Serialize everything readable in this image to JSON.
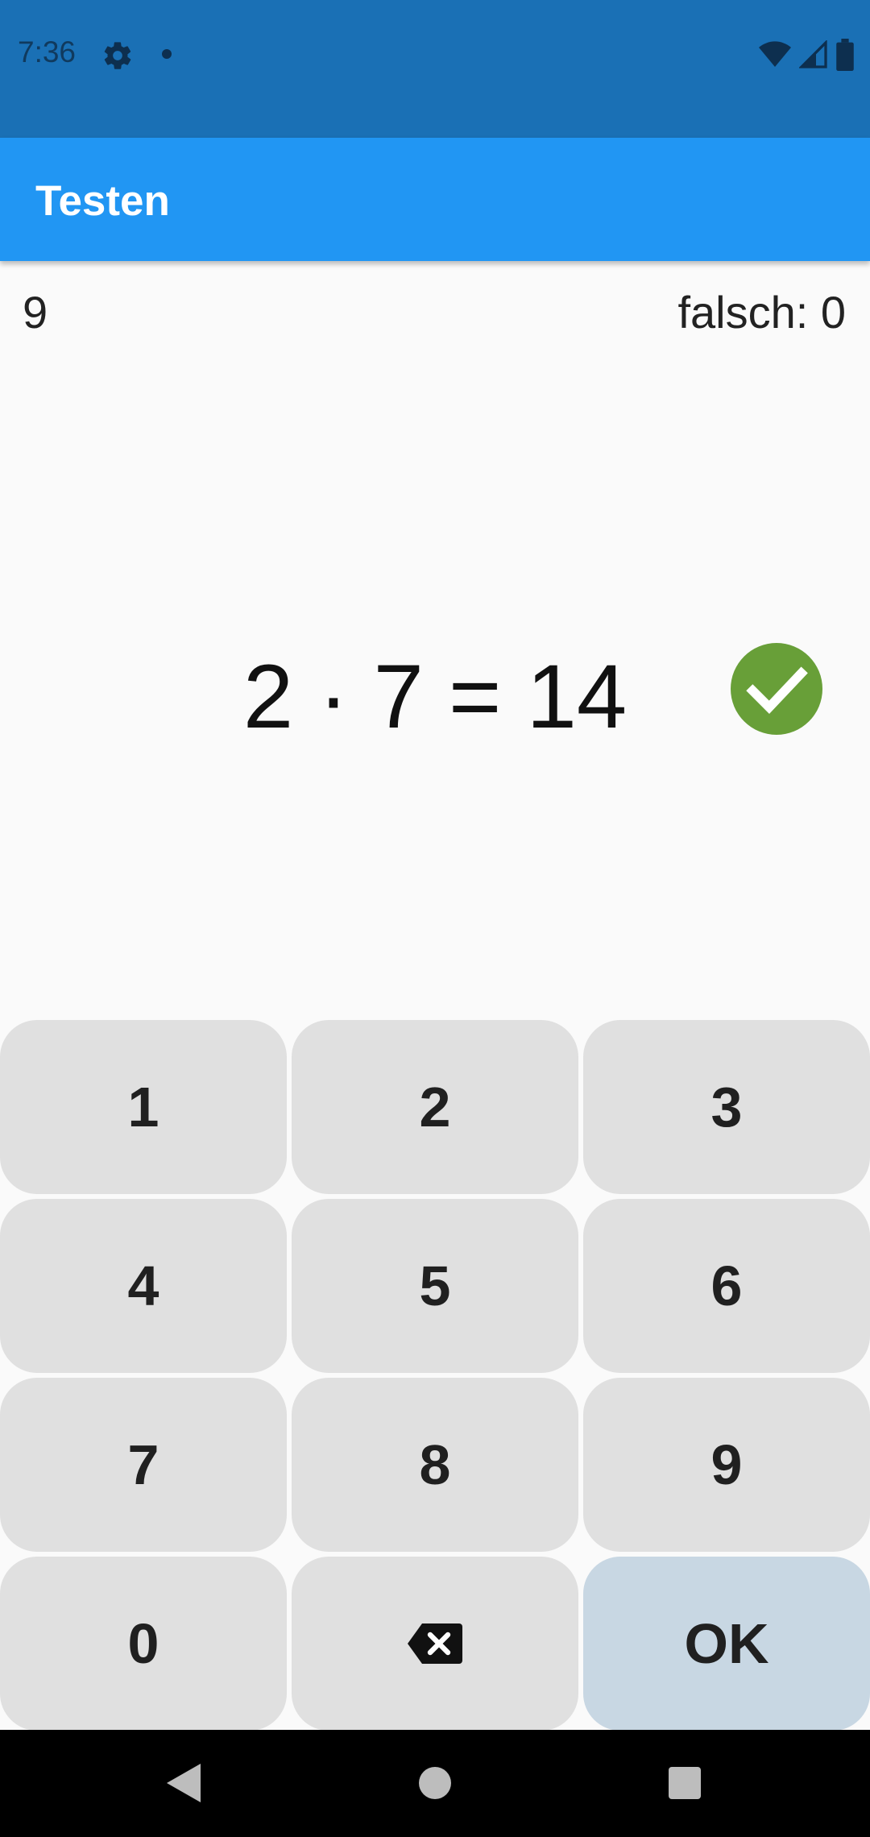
{
  "status_bar": {
    "time": "7:36",
    "icons": [
      "gear-icon",
      "notification-dot",
      "wifi-icon",
      "cell-signal-icon",
      "battery-icon"
    ]
  },
  "app_bar": {
    "title": "Testen",
    "color": "#2196f3"
  },
  "counters": {
    "left": "9",
    "right": "falsch: 0"
  },
  "exercise": {
    "equation": "2 · 7 = 14",
    "result_icon": "check-circle-icon",
    "result_color": "#689f38"
  },
  "keypad": {
    "keys": [
      "1",
      "2",
      "3",
      "4",
      "5",
      "6",
      "7",
      "8",
      "9",
      "0"
    ],
    "backspace_icon": "backspace-icon",
    "ok_label": "OK"
  },
  "nav_bar": {
    "icons": [
      "back-icon",
      "home-icon",
      "recents-icon"
    ]
  }
}
